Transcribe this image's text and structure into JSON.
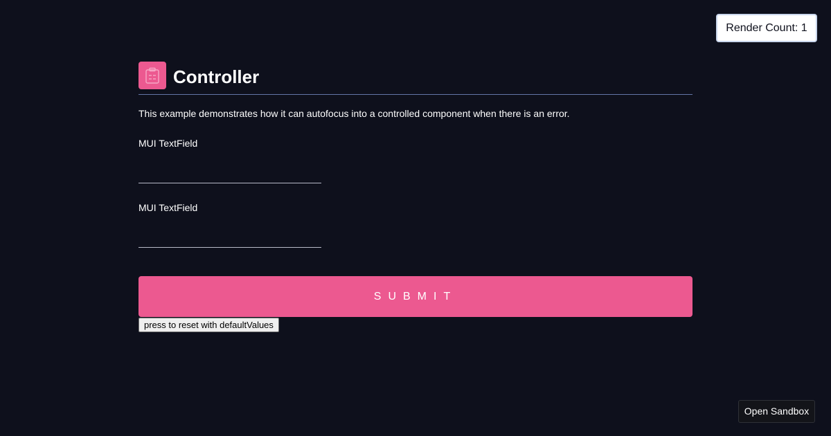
{
  "render_count": {
    "label": "Render Count: 1"
  },
  "header": {
    "title": "Controller",
    "icon": "clipboard-icon"
  },
  "description": "This example demonstrates how it can autofocus into a controlled component when there is an error.",
  "form": {
    "fields": [
      {
        "label": "MUI TextField",
        "value": ""
      },
      {
        "label": "MUI TextField",
        "value": ""
      }
    ],
    "submit_label": "SUBMIT",
    "reset_label": "press to reset with defaultValues"
  },
  "sandbox": {
    "label": "Open Sandbox"
  },
  "colors": {
    "background": "#0e101c",
    "accent": "#ec5990",
    "divider": "#6476a8"
  }
}
